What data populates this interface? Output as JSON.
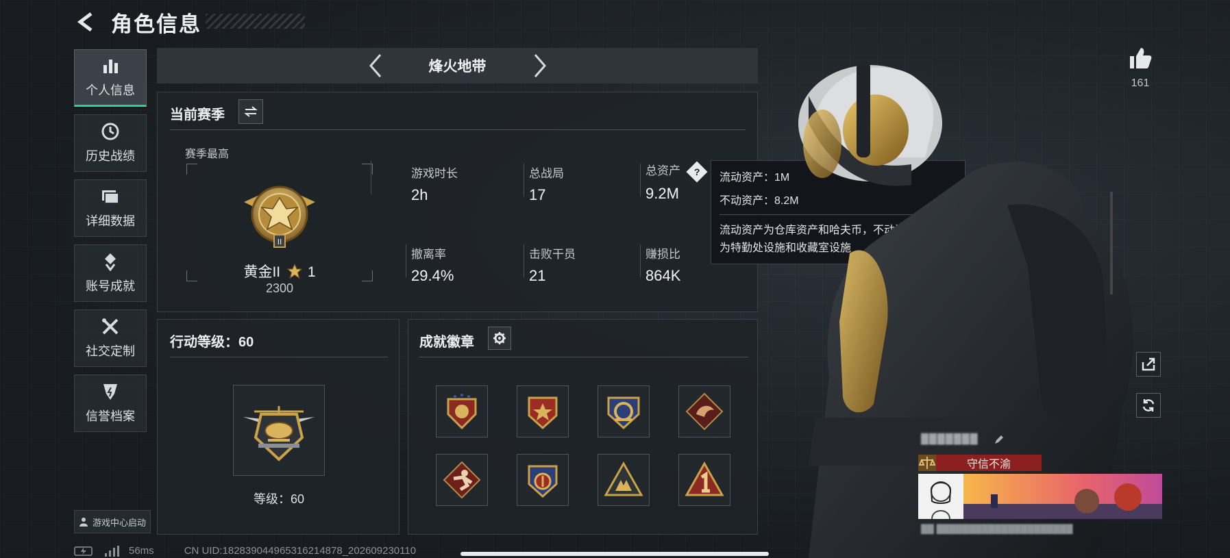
{
  "header": {
    "title": "角色信息"
  },
  "sidebar": {
    "items": [
      {
        "label": "个人信息",
        "icon": "bar-chart-icon",
        "active": true
      },
      {
        "label": "历史战绩",
        "icon": "history-clock-icon",
        "active": false
      },
      {
        "label": "详细数据",
        "icon": "folder-stack-icon",
        "active": false
      },
      {
        "label": "账号成就",
        "icon": "achievement-medal-icon",
        "active": false
      },
      {
        "label": "社交定制",
        "icon": "wrench-screwdriver-icon",
        "active": false
      },
      {
        "label": "信誉档案",
        "icon": "shield-badge-icon",
        "active": false
      }
    ],
    "launch_label": "游戏中心启动"
  },
  "mode_selector": {
    "title": "烽火地带"
  },
  "season": {
    "title": "当前赛季",
    "best_label": "赛季最高",
    "rank_name": "黄金II",
    "rank_stars": "1",
    "rank_score": "2300",
    "stats": [
      {
        "label": "游戏时长",
        "value": "2h"
      },
      {
        "label": "总战局",
        "value": "17"
      },
      {
        "label": "总资产",
        "value": "9.2M"
      },
      {
        "label": "撤离率",
        "value": "29.4%"
      },
      {
        "label": "击败干员",
        "value": "21"
      },
      {
        "label": "赚损比",
        "value": "864K"
      }
    ]
  },
  "tooltip": {
    "liquid": "流动资产：1M",
    "fixed": "不动资产：8.2M",
    "desc_line1": "流动资产为仓库资产和哈夫币，不动资产",
    "desc_line2": "为特勤处设施和收藏室设施"
  },
  "level": {
    "title": "行动等级：60",
    "level_text": "等级：60"
  },
  "badges": {
    "title": "成就徽章"
  },
  "likes": {
    "count": "161"
  },
  "player_card": {
    "title": "守信不渝"
  },
  "footer": {
    "latency": "56ms",
    "uid": "CN UID:18283904496531621487​8_202609230110"
  },
  "colors": {
    "accent": "#27d48f",
    "gold": "#c9a24a",
    "title_bar": "#8c1f1f"
  }
}
